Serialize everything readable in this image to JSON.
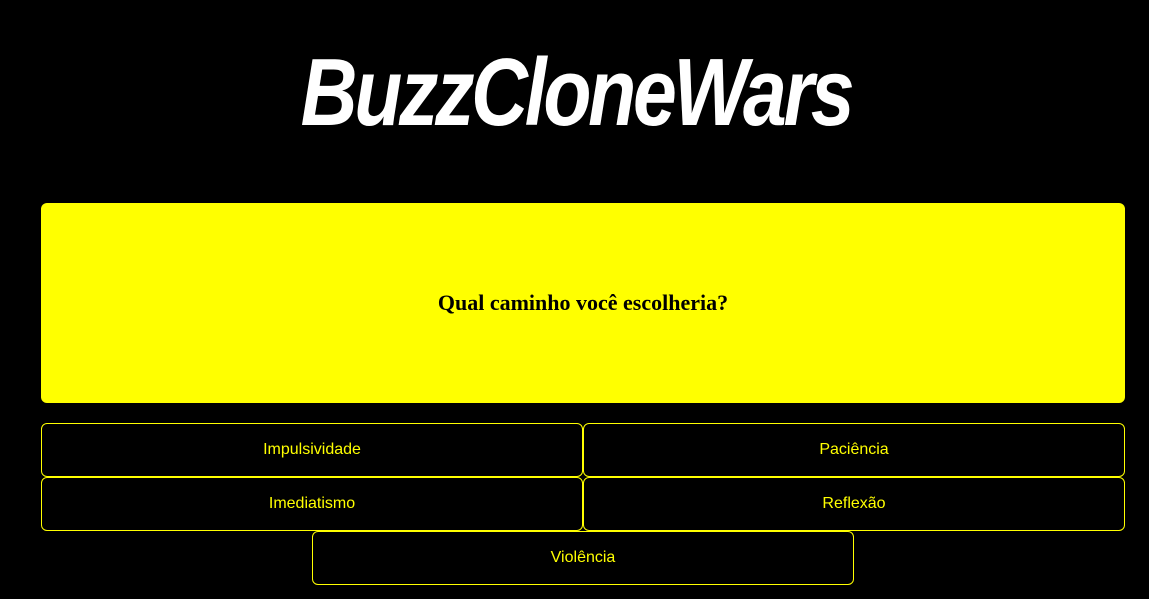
{
  "app": {
    "title": "BuzzCloneWars"
  },
  "question": {
    "text": "Qual caminho você escolheria?"
  },
  "answers": [
    {
      "label": "Impulsividade"
    },
    {
      "label": "Paciência"
    },
    {
      "label": "Imediatismo"
    },
    {
      "label": "Reflexão"
    },
    {
      "label": "Violência"
    }
  ],
  "colors": {
    "background": "#000000",
    "accent": "#ffff00",
    "logo": "#ffffff",
    "question_text": "#000000"
  }
}
